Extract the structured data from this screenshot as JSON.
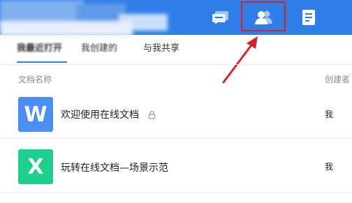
{
  "topbar": {
    "icons": {
      "chat": "chat-bubble-icon",
      "people": "people-icon",
      "doc": "document-icon"
    },
    "accent": "#2f7ee8"
  },
  "annotation": {
    "box_color": "#d6232b",
    "arrow_color": "#d6232b"
  },
  "tabs": [
    {
      "label": "我最近打开"
    },
    {
      "label": "我创建的"
    },
    {
      "label": "与我共享"
    }
  ],
  "table": {
    "headers": {
      "name": "文档名称",
      "creator": "创建者"
    },
    "rows": [
      {
        "icon_letter": "W",
        "icon_color": "#4a8ef6",
        "name": "欢迎使用在线文档",
        "locked": true,
        "creator": "我"
      },
      {
        "icon_letter": "X",
        "icon_color": "#1fcf8e",
        "name": "玩转在线文档—场景示范",
        "locked": false,
        "creator": "我"
      }
    ]
  }
}
